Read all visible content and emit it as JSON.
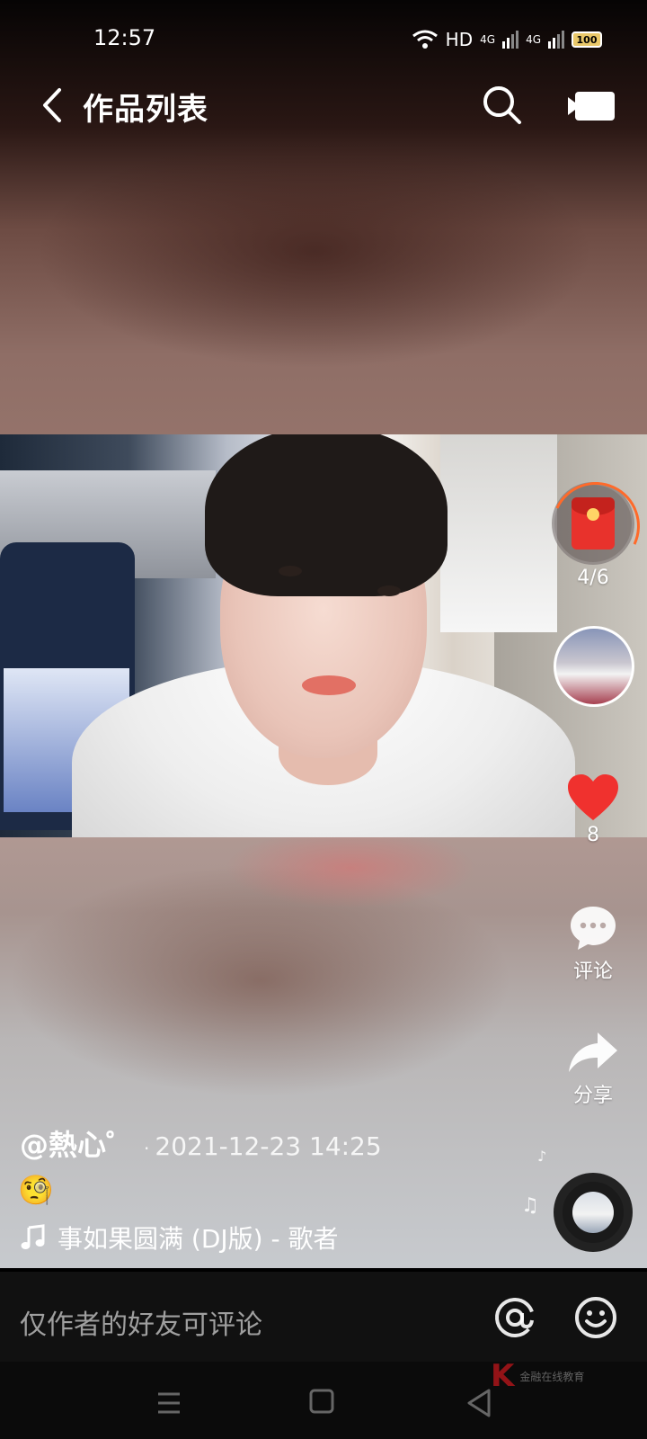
{
  "status_bar": {
    "time": "12:57",
    "network": "HD",
    "signal_1": "4G",
    "signal_2": "4G",
    "battery": "100"
  },
  "top_bar": {
    "title": "作品列表",
    "icons": {
      "back": "chevron-left-icon",
      "search": "search-icon",
      "camera": "video-camera-icon"
    }
  },
  "side_actions": {
    "red_packet_progress": "4/6",
    "likes_count": "8",
    "comment_label": "评论",
    "share_label": "分享"
  },
  "post": {
    "author": "@熱心゜",
    "date": "2021-12-23 14:25",
    "caption_emoji": "🧐",
    "music": "事如果圆满 (DJ版) - 歌者"
  },
  "comment_bar": {
    "hint": "仅作者的好友可评论"
  },
  "watermark_text": "金融在线教育",
  "colors": {
    "like_red": "#f0312e",
    "red_packet": "#e8322c",
    "accent_orange": "#ff6a2a"
  }
}
